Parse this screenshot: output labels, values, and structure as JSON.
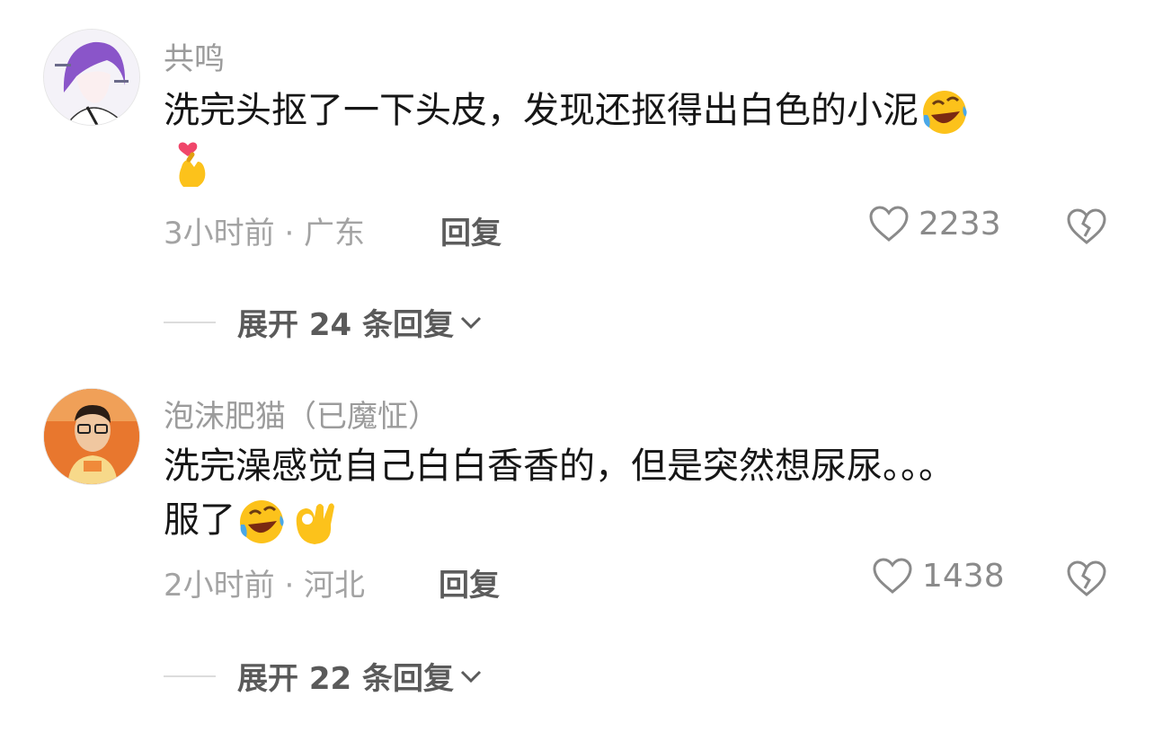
{
  "comments": [
    {
      "username": "共鸣",
      "text_line1": "洗完头抠了一下头皮，发现还抠得出白色的小泥",
      "emojis_line1": [
        "rolling-laugh-emoji"
      ],
      "emojis_line2": [
        "finger-heart-emoji"
      ],
      "time_location": "3小时前 · 广东",
      "reply_label": "回复",
      "likes": "2233",
      "expand_label": "展开 24 条回复",
      "avatar_icon": "purple-hair-anime-avatar"
    },
    {
      "username": "泡沫肥猫（已魔怔）",
      "text_line1": "洗完澡感觉自己白白香香的，但是突然想尿尿。。。",
      "text_line2": "服了",
      "emojis_line2": [
        "rolling-laugh-emoji",
        "ok-hand-emoji"
      ],
      "time_location": "2小时前 · 河北",
      "reply_label": "回复",
      "likes": "1438",
      "expand_label": "展开 22 条回复",
      "avatar_icon": "person-photo-avatar"
    }
  ],
  "icons": {
    "like": "heart-outline-icon",
    "dislike": "broken-heart-icon",
    "expand": "chevron-down-icon"
  },
  "colors": {
    "username": "#9b9b9b",
    "text": "#161616",
    "meta": "#a3a3a3",
    "reply": "#5c5c5c"
  }
}
